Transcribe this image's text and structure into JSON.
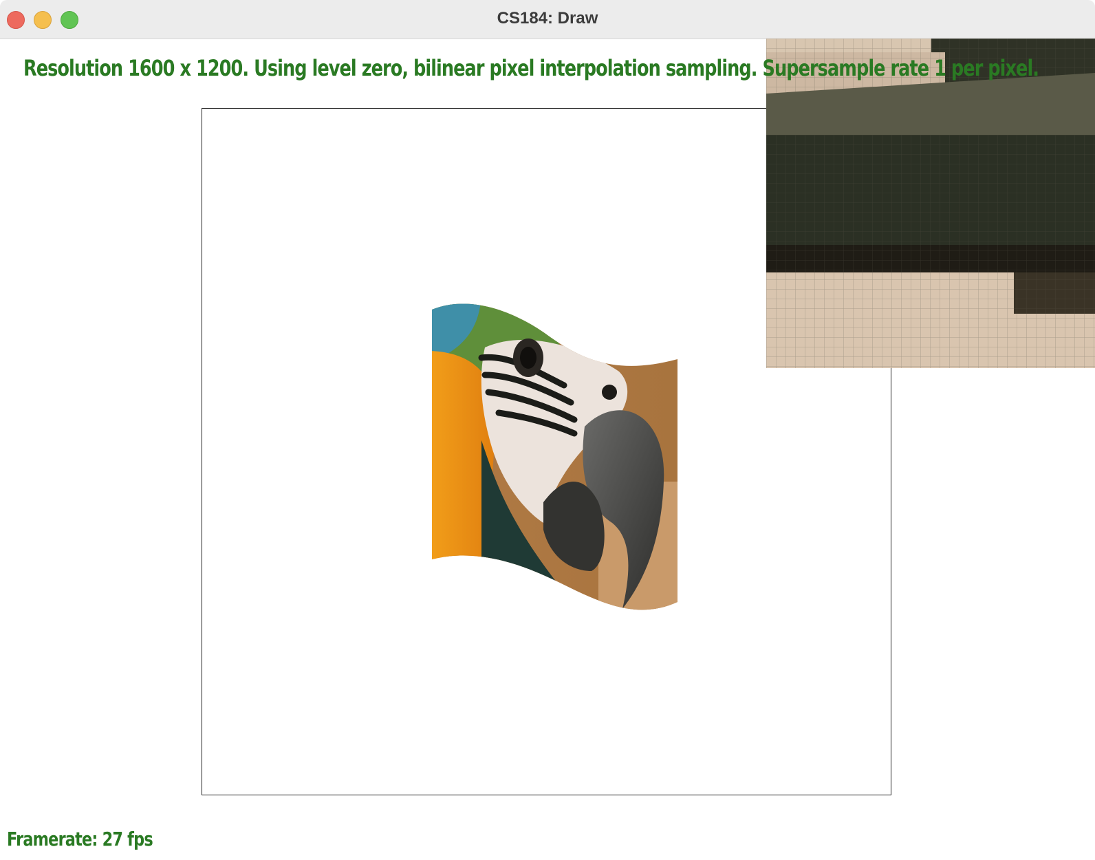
{
  "window": {
    "title": "CS184: Draw",
    "controls": [
      "close",
      "minimize",
      "maximize"
    ]
  },
  "status": {
    "line": "Resolution 1600 x 1200. Using level zero, bilinear pixel interpolation sampling. Supersample rate 1 per pixel."
  },
  "canvas": {
    "content": "warped parrot texture (macaw head) mapped onto a wavy quad",
    "zoom_inset": "magnified pixel grid of the texture"
  },
  "footer": {
    "framerate": "Framerate: 27 fps"
  },
  "colors": {
    "status_text": "#2a7a23",
    "close": "#ed6a5e",
    "minimize": "#f5bf4f",
    "maximize": "#61c454"
  }
}
